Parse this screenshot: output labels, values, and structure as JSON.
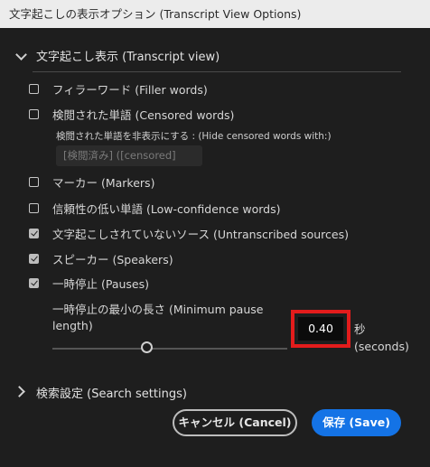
{
  "window": {
    "title": "文字起こしの表示オプション (Transcript View Options)"
  },
  "transcript_view": {
    "header": "文字起こし表示 (Transcript view)",
    "expanded": true,
    "items": [
      {
        "label": "フィラーワード (Filler words)",
        "checked": false
      },
      {
        "label": "検閲された単語 (Censored words)",
        "checked": false
      },
      {
        "label": "マーカー (Markers)",
        "checked": false
      },
      {
        "label": "信頼性の低い単語 (Low-confidence words)",
        "checked": false
      },
      {
        "label": "文字起こしされていないソース (Untranscribed sources)",
        "checked": true
      },
      {
        "label": "スピーカー (Speakers)",
        "checked": true
      },
      {
        "label": "一時停止 (Pauses)",
        "checked": true
      }
    ],
    "censored_hide_label": "検閲された単語を非表示にする : (Hide censored words with:)",
    "censored_hide_placeholder": "[検閲済み] ([censored]",
    "min_pause_label": "一時停止の最小の長さ (Minimum pause length)",
    "min_pause_value": "0.40",
    "min_pause_slider_fraction": 0.4,
    "unit_jp": "秒",
    "unit_en": "(seconds)"
  },
  "search_settings": {
    "header": "検索設定 (Search settings)",
    "expanded": false
  },
  "buttons": {
    "cancel": "キャンセル (Cancel)",
    "save": "保存 (Save)"
  },
  "colors": {
    "accent": "#1473e6",
    "highlight": "#e31c1c"
  },
  "icons": {
    "expand": "chevron-down-icon",
    "collapse": "chevron-right-icon"
  }
}
